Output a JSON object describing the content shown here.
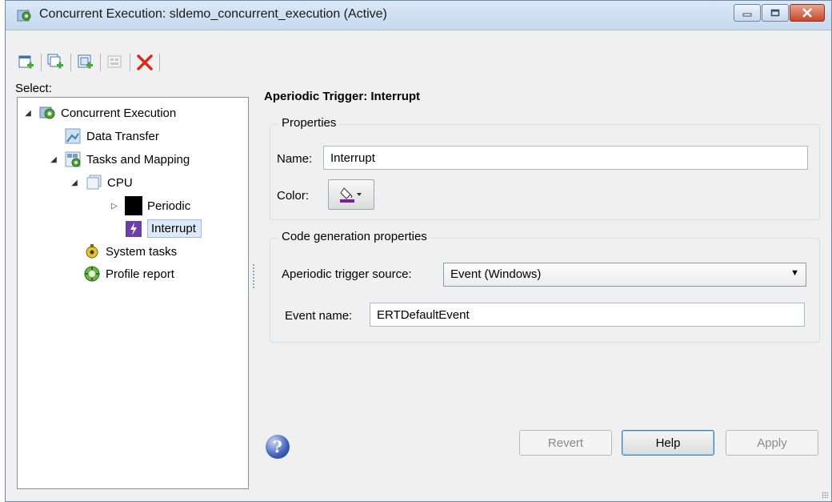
{
  "window": {
    "title": "Concurrent Execution: sldemo_concurrent_execution (Active)"
  },
  "toolbar": {
    "buttons": [
      "add-task-icon",
      "add-task-group-icon",
      "add-triggered-task-icon",
      "add-disabled-icon",
      "delete-icon"
    ]
  },
  "tree": {
    "select_label": "Select:",
    "items": [
      {
        "label": "Concurrent Execution"
      },
      {
        "label": "Data Transfer"
      },
      {
        "label": "Tasks and Mapping"
      },
      {
        "label": "CPU"
      },
      {
        "label": "Periodic"
      },
      {
        "label": "Interrupt"
      },
      {
        "label": "System tasks"
      },
      {
        "label": "Profile report"
      }
    ]
  },
  "panel": {
    "title": "Aperiodic Trigger: Interrupt",
    "properties": {
      "group_title": "Properties",
      "name_label": "Name:",
      "name_value": "Interrupt",
      "color_label": "Color:",
      "color_swatch": "#7a1fa2"
    },
    "codegen": {
      "group_title": "Code generation properties",
      "source_label": "Aperiodic trigger source:",
      "source_value": "Event (Windows)",
      "event_label": "Event name:",
      "event_value": "ERTDefaultEvent"
    }
  },
  "buttons": {
    "revert": "Revert",
    "help": "Help",
    "apply": "Apply"
  }
}
